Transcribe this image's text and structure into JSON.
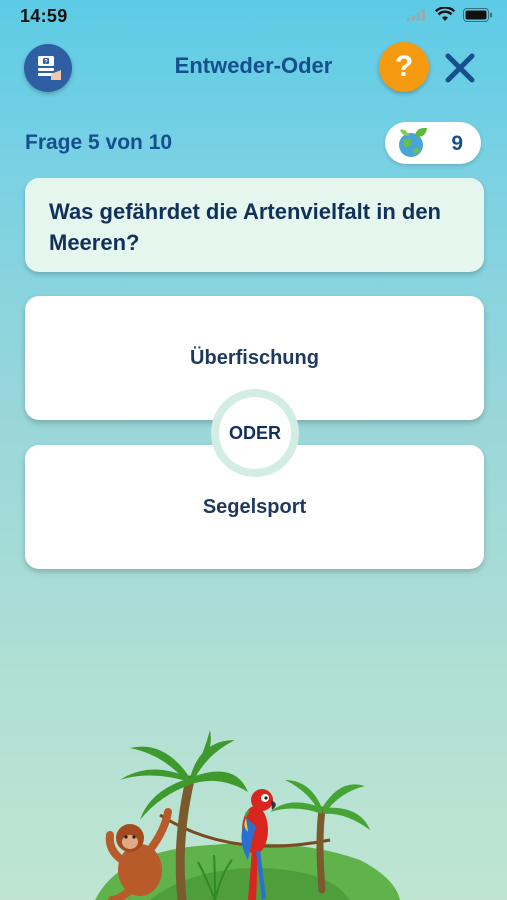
{
  "status_bar": {
    "time": "14:59"
  },
  "header": {
    "title": "Entweder-Oder",
    "help_label": "?",
    "icons": {
      "menu": "quiz-menu-icon",
      "close": "close-icon"
    }
  },
  "progress_text": "Frage 5 von 10",
  "score": {
    "value": "9",
    "icon": "globe-leaf-icon"
  },
  "question": "Was gefährdet die Artenvielfalt in den Meeren?",
  "answers": [
    {
      "label": "Überfischung"
    },
    {
      "label": "Segelsport"
    }
  ],
  "divider_label": "ODER",
  "colors": {
    "primary_text": "#154f8e",
    "help_button": "#f59a11",
    "menu_button": "#2e5fa3",
    "question_bg": "#e5f6ef"
  }
}
